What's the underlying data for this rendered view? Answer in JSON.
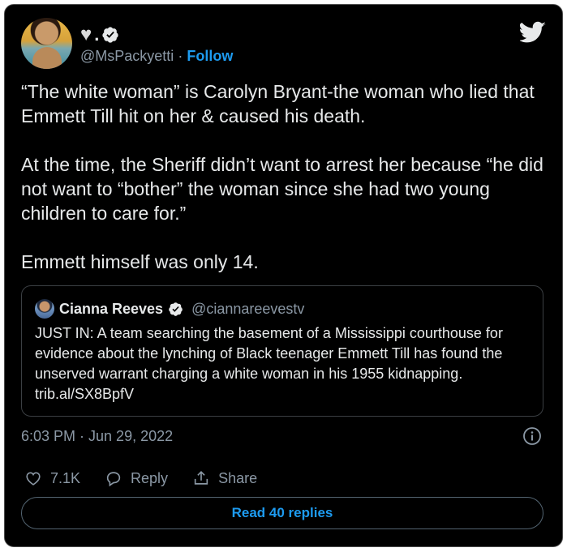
{
  "author": {
    "display_name_icon": "heart-icon",
    "display_name_suffix": ".",
    "handle": "@MsPackyetti",
    "separator": "·",
    "follow_label": "Follow"
  },
  "tweet": {
    "paragraphs": [
      "“The white woman” is Carolyn Bryant-the woman who lied that Emmett Till hit on her & caused his death.",
      "At the time, the Sheriff didn’t want to arrest her because “he did not want to “bother” the woman since she had two young children to care for.”",
      "Emmett himself was only 14."
    ],
    "timestamp": "6:03 PM · Jun 29, 2022"
  },
  "quoted": {
    "name": "Cianna Reeves",
    "handle": "@ciannareevestv",
    "text": "JUST IN: A team searching the basement of a Mississippi courthouse for evidence about the lynching of Black teenager Emmett Till has found the unserved warrant charging a white woman in his 1955 kidnapping. trib.al/SX8BpfV"
  },
  "actions": {
    "like_count": "7.1K",
    "reply_label": "Reply",
    "share_label": "Share"
  },
  "read_replies_label": "Read 40 replies",
  "colors": {
    "background": "#000000",
    "accent": "#1d9bf0",
    "muted": "#8b98a5",
    "text": "#e7e9ea"
  }
}
